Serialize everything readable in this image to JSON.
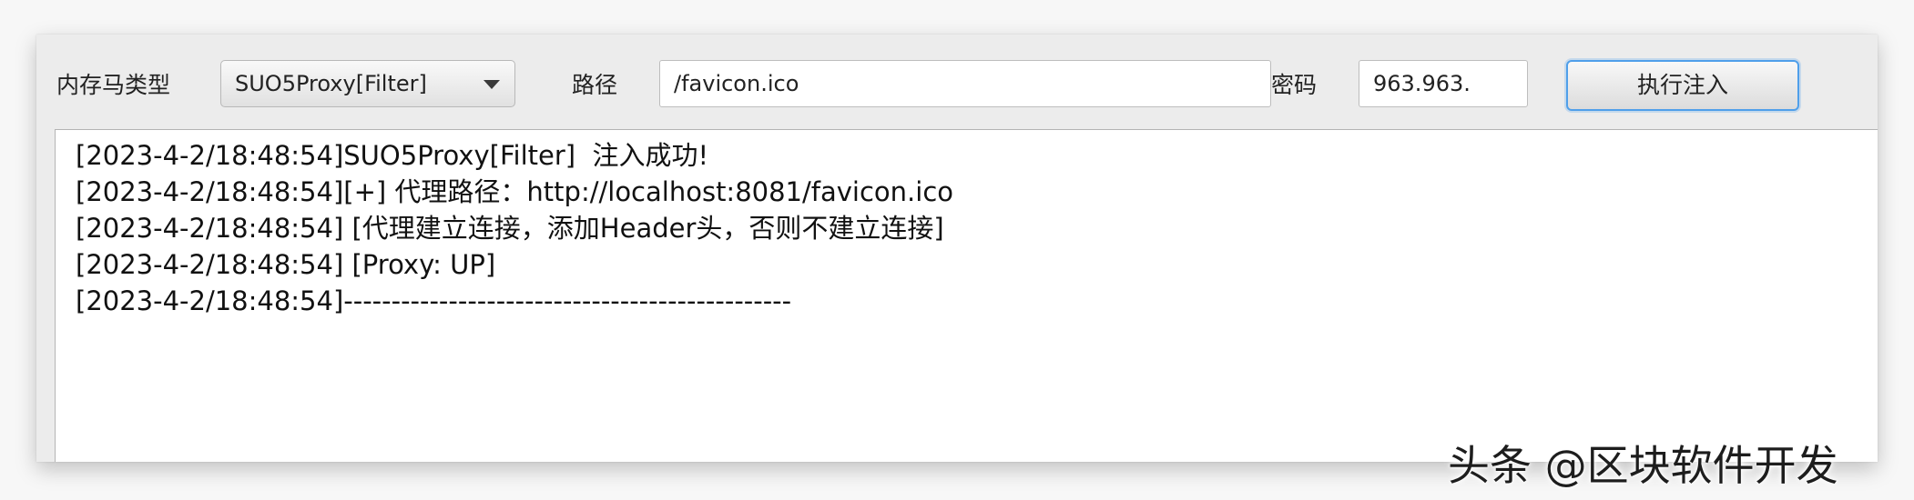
{
  "toolbar": {
    "type_label": "内存马类型",
    "type_select_value": "SUO5Proxy[Filter]",
    "path_label": "路径",
    "path_value": "/favicon.ico",
    "password_label": "密码",
    "password_value": "963.963.",
    "inject_button_label": "执行注入"
  },
  "log": {
    "lines": [
      "[2023-4-2/18:48:54]SUO5Proxy[Filter]  注入成功!",
      "[2023-4-2/18:48:54][+] 代理路径：http://localhost:8081/favicon.ico",
      "[2023-4-2/18:48:54] [代理建立连接，添加Header头，否则不建立连接]",
      "[2023-4-2/18:48:54] [Proxy: UP]",
      "[2023-4-2/18:48:54]-----------------------------------------------"
    ]
  },
  "watermark": {
    "text": "头条 @区块软件开发"
  },
  "icons": {
    "select_caret": "chevron-down-icon"
  }
}
